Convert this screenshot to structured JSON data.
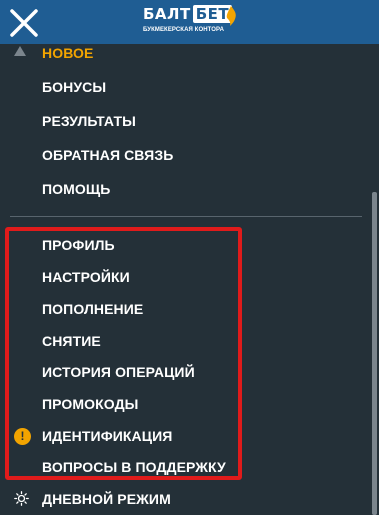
{
  "header": {
    "logo_main": "БАЛТ",
    "logo_accent": "БЕТ",
    "logo_subtitle": "БУКМЕКЕРСКАЯ КОНТОРА"
  },
  "menu": {
    "items": [
      {
        "label": "НОВОЕ"
      },
      {
        "label": "БОНУСЫ"
      },
      {
        "label": "РЕЗУЛЬТАТЫ"
      },
      {
        "label": "ОБРАТНАЯ СВЯЗЬ"
      },
      {
        "label": "ПОМОЩЬ"
      },
      {
        "label": "ПРОФИЛЬ"
      },
      {
        "label": "НАСТРОЙКИ"
      },
      {
        "label": "ПОПОЛНЕНИЕ"
      },
      {
        "label": "СНЯТИЕ"
      },
      {
        "label": "ИСТОРИЯ ОПЕРАЦИЙ"
      },
      {
        "label": "ПРОМОКОДЫ"
      },
      {
        "label": "ИДЕНТИФИКАЦИЯ"
      },
      {
        "label": "ВОПРОСЫ В ПОДДЕРЖКУ"
      },
      {
        "label": "ДНЕВНОЙ РЕЖИМ"
      }
    ]
  },
  "identification_alert": "!",
  "colors": {
    "background": "#243038",
    "header": "#1f5d93",
    "accent": "#f2a400",
    "highlight_frame": "#e01b1b"
  }
}
